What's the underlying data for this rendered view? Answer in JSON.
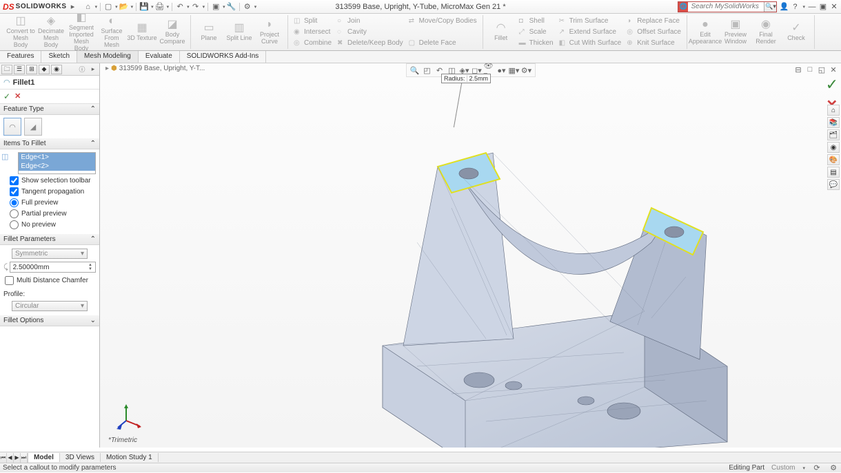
{
  "app": {
    "logo_ds": "DS",
    "logo_text": "SOLIDWORKS",
    "title": "313599 Base, Upright, Y-Tube, MicroMax Gen 21 *",
    "search_placeholder": "Search MySolidWorks"
  },
  "ribbon": {
    "convert": "Convert to Mesh Body",
    "decimate": "Decimate Mesh Body",
    "segment": "Segment Imported Mesh Body",
    "surface_mesh": "Surface From Mesh",
    "3dtex": "3D Texture",
    "bodycmp": "Body Compare",
    "plane": "Plane",
    "splitline": "Split Line",
    "projcurve": "Project Curve",
    "split": "Split",
    "intersect": "Intersect",
    "combine": "Combine",
    "join": "Join",
    "cavity": "Cavity",
    "dkb": "Delete/Keep Body",
    "movecopy": "Move/Copy Bodies",
    "fillet": "Fillet",
    "shell": "Shell",
    "scale": "Scale",
    "deleteface": "Delete Face",
    "thicken": "Thicken",
    "trimsrf": "Trim Surface",
    "extendsrf": "Extend Surface",
    "cutwsrf": "Cut With Surface",
    "replaceface": "Replace Face",
    "offsetsrf": "Offset Surface",
    "knitsrf": "Knit Surface",
    "editappr": "Edit Appearance",
    "prevwin": "Preview Window",
    "finalrender": "Final Render",
    "check": "Check"
  },
  "tabs": [
    "Features",
    "Sketch",
    "Mesh Modeling",
    "Evaluate",
    "SOLIDWORKS Add-Ins"
  ],
  "active_tab_index": 2,
  "crumb": "313599 Base, Upright, Y-T...",
  "panel": {
    "feature_name": "Fillet1",
    "sections": {
      "feature_type": "Feature Type",
      "items_to_fillet": "Items To Fillet",
      "fillet_params": "Fillet Parameters",
      "profile": "Profile:",
      "fillet_options": "Fillet Options"
    },
    "edges": [
      "Edge<1>",
      "Edge<2>"
    ],
    "show_sel_toolbar": "Show selection toolbar",
    "tangent_prop": "Tangent propagation",
    "full_preview": "Full preview",
    "partial_preview": "Partial preview",
    "no_preview": "No preview",
    "symmetric": "Symmetric",
    "radius_value": "2.50000mm",
    "multi_dist": "Multi Distance Chamfer",
    "circular": "Circular"
  },
  "callout": {
    "label": "Radius:",
    "value": "2.5mm"
  },
  "sheet_tabs": [
    "Model",
    "3D Views",
    "Motion Study 1"
  ],
  "status": {
    "msg": "Select a callout to modify parameters",
    "editing": "Editing Part",
    "custom": "Custom"
  },
  "trimetric": "*Trimetric"
}
